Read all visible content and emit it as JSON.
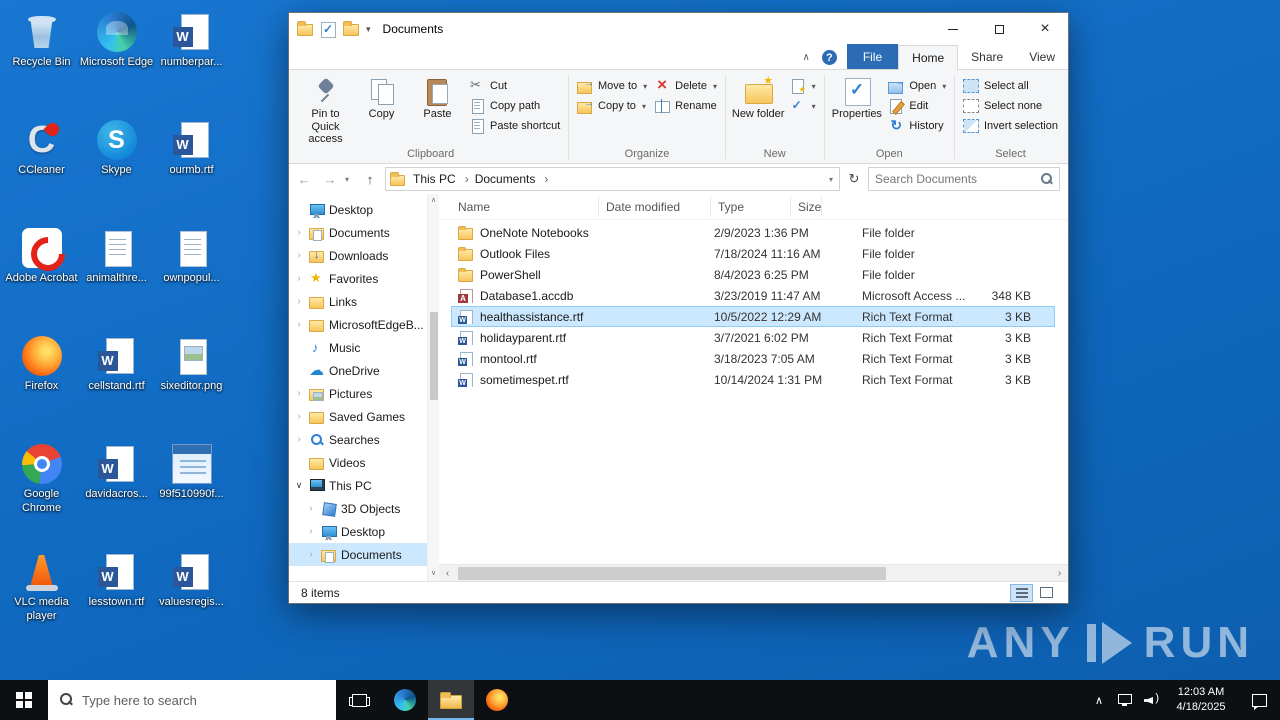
{
  "desktop": {
    "icons": [
      {
        "label": "Recycle Bin",
        "icon": "recycle-bin"
      },
      {
        "label": "CCleaner",
        "icon": "ccleaner"
      },
      {
        "label": "Adobe Acrobat",
        "icon": "acrobat"
      },
      {
        "label": "Firefox",
        "icon": "firefox"
      },
      {
        "label": "Google Chrome",
        "icon": "chrome"
      },
      {
        "label": "VLC media player",
        "icon": "vlc"
      },
      {
        "label": "Microsoft Edge",
        "icon": "edge"
      },
      {
        "label": "Skype",
        "icon": "skype"
      },
      {
        "label": "animalthre...",
        "icon": "notepad"
      },
      {
        "label": "cellstand.rtf",
        "icon": "word"
      },
      {
        "label": "davidacros...",
        "icon": "word"
      },
      {
        "label": "lesstown.rtf",
        "icon": "word"
      },
      {
        "label": "numberpar...",
        "icon": "word"
      },
      {
        "label": "ourmb.rtf",
        "icon": "word"
      },
      {
        "label": "ownpopul...",
        "icon": "notepad"
      },
      {
        "label": "sixeditor.png",
        "icon": "image"
      },
      {
        "label": "99f510990f...",
        "icon": "app"
      },
      {
        "label": "valuesregis...",
        "icon": "word"
      }
    ]
  },
  "explorer": {
    "title": "Documents",
    "window_controls": {
      "close": "×"
    },
    "tabs": [
      {
        "label": "File",
        "kind": "file"
      },
      {
        "label": "Home",
        "kind": "active"
      },
      {
        "label": "Share",
        "kind": "normal"
      },
      {
        "label": "View",
        "kind": "normal"
      }
    ],
    "ribbon": {
      "pin": "Pin to Quick access",
      "copy": "Copy",
      "paste": "Paste",
      "cut": "Cut",
      "copy_path": "Copy path",
      "paste_shortcut": "Paste shortcut",
      "move_to": "Move to",
      "copy_to": "Copy to",
      "delete": "Delete",
      "rename": "Rename",
      "new_folder": "New folder",
      "properties": "Properties",
      "open": "Open",
      "edit": "Edit",
      "history": "History",
      "select_all": "Select all",
      "select_none": "Select none",
      "invert_selection": "Invert selection",
      "groups": {
        "clipboard": "Clipboard",
        "organize": "Organize",
        "new": "New",
        "open": "Open",
        "select": "Select"
      }
    },
    "address": {
      "crumbs": [
        "This PC",
        "Documents"
      ],
      "search_placeholder": "Search Documents"
    },
    "nav": [
      {
        "label": "Desktop",
        "icon": "desktop",
        "arrow": "none",
        "indent": 0
      },
      {
        "label": "Documents",
        "icon": "folder-documents",
        "arrow": "right",
        "indent": 0
      },
      {
        "label": "Downloads",
        "icon": "downloads",
        "arrow": "right",
        "indent": 0
      },
      {
        "label": "Favorites",
        "icon": "favorites",
        "arrow": "right",
        "indent": 0
      },
      {
        "label": "Links",
        "icon": "folder",
        "arrow": "right",
        "indent": 0
      },
      {
        "label": "MicrosoftEdgeB...",
        "icon": "folder",
        "arrow": "right",
        "indent": 0
      },
      {
        "label": "Music",
        "icon": "music",
        "arrow": "none",
        "indent": 0
      },
      {
        "label": "OneDrive",
        "icon": "onedrive",
        "arrow": "none",
        "indent": 0
      },
      {
        "label": "Pictures",
        "icon": "pictures",
        "arrow": "right",
        "indent": 0
      },
      {
        "label": "Saved Games",
        "icon": "saved-games",
        "arrow": "right",
        "indent": 0
      },
      {
        "label": "Searches",
        "icon": "searches",
        "arrow": "right",
        "indent": 0
      },
      {
        "label": "Videos",
        "icon": "videos",
        "arrow": "none",
        "indent": 0
      },
      {
        "label": "This PC",
        "icon": "this-pc",
        "arrow": "down",
        "indent": 0
      },
      {
        "label": "3D Objects",
        "icon": "3d-objects",
        "arrow": "right",
        "indent": 1
      },
      {
        "label": "Desktop",
        "icon": "desktop",
        "arrow": "right",
        "indent": 1
      },
      {
        "label": "Documents",
        "icon": "folder-documents",
        "arrow": "right",
        "indent": 1,
        "selected": true
      }
    ],
    "list": {
      "columns": [
        "Name",
        "Date modified",
        "Type",
        "Size"
      ],
      "rows": [
        {
          "name": "OneNote Notebooks",
          "modified": "2/9/2023 1:36 PM",
          "type": "File folder",
          "size": "",
          "icon": "folder"
        },
        {
          "name": "Outlook Files",
          "modified": "7/18/2024 11:16 AM",
          "type": "File folder",
          "size": "",
          "icon": "folder"
        },
        {
          "name": "PowerShell",
          "modified": "8/4/2023 6:25 PM",
          "type": "File folder",
          "size": "",
          "icon": "folder"
        },
        {
          "name": "Database1.accdb",
          "modified": "3/23/2019 11:47 AM",
          "type": "Microsoft Access ...",
          "size": "348 KB",
          "icon": "access"
        },
        {
          "name": "healthassistance.rtf",
          "modified": "10/5/2022 12:29 AM",
          "type": "Rich Text Format",
          "size": "3 KB",
          "icon": "rtf",
          "selected": true
        },
        {
          "name": "holidayparent.rtf",
          "modified": "3/7/2021 6:02 PM",
          "type": "Rich Text Format",
          "size": "3 KB",
          "icon": "rtf"
        },
        {
          "name": "montool.rtf",
          "modified": "3/18/2023 7:05 AM",
          "type": "Rich Text Format",
          "size": "3 KB",
          "icon": "rtf"
        },
        {
          "name": "sometimespet.rtf",
          "modified": "10/14/2024 1:31 PM",
          "type": "Rich Text Format",
          "size": "3 KB",
          "icon": "rtf"
        }
      ]
    },
    "status": "8 items"
  },
  "icons": {
    "back_arrow": "←",
    "forward_arrow": "→",
    "up_arrow": "↑",
    "refresh": "↻",
    "dropdown_caret": "▾",
    "collapse_caret": "∧",
    "help": "?",
    "scroll_up": "∧",
    "scroll_down": "∨",
    "scroll_left": "‹",
    "scroll_right": "›"
  },
  "taskbar": {
    "search_placeholder": "Type here to search",
    "time": "12:03 AM",
    "date": "4/18/2025"
  },
  "watermark": {
    "left": "ANY",
    "right": "RUN"
  }
}
